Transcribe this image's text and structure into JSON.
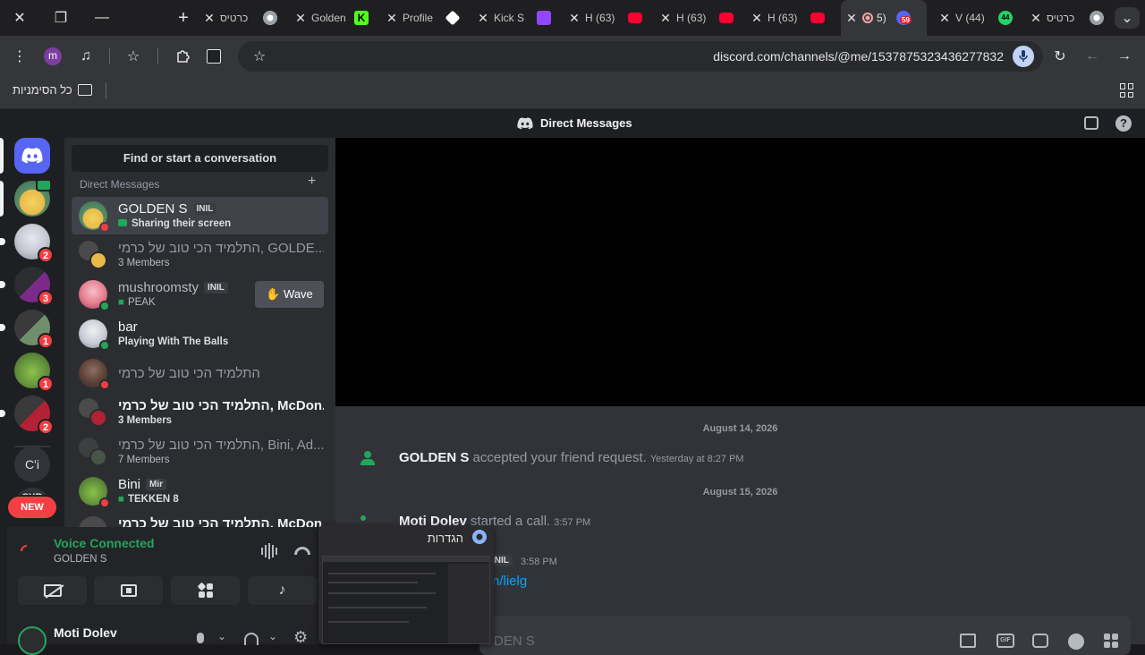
{
  "browser": {
    "tabs": [
      {
        "label": "כרטיס",
        "icon": "chrome-icon"
      },
      {
        "label": "Golden",
        "icon": "kick-icon"
      },
      {
        "label": "Profile",
        "icon": "extension-icon"
      },
      {
        "label": "Kick S",
        "icon": "twitch-icon"
      },
      {
        "label": "(63) H",
        "icon": "youtube-icon"
      },
      {
        "label": "(63) H",
        "icon": "youtube-icon"
      },
      {
        "label": "(63) H",
        "icon": "youtube-icon"
      },
      {
        "label": "(5",
        "icon": "discord-icon",
        "badge": "59"
      },
      {
        "label": "(44) V",
        "icon": "whatsapp-icon",
        "badge": "44"
      },
      {
        "label": "כרטיס",
        "icon": "chrome-icon"
      }
    ],
    "profile_initial": "m",
    "url": "discord.com/channels/@me/1537875323436277832",
    "bookmarks_label": "כל הסימניות"
  },
  "discord": {
    "title": "Direct Messages",
    "guild_badges": [
      "2",
      "3",
      "1",
      "1",
      "2"
    ],
    "guild_text": "C'i",
    "guild_text2": "SYR",
    "new_label": "NEW",
    "find_label": "Find or start a conversation",
    "dm_header": "Direct Messages",
    "dms": [
      {
        "name": "GOLDEN S",
        "tag": "INIL",
        "sub": "Sharing their screen"
      },
      {
        "name": "התלמיד הכי טוב של כרמי, GOLDE...",
        "sub": "3 Members"
      },
      {
        "name": "mushroomsty",
        "tag": "INIL",
        "sub": "PEAK"
      },
      {
        "name": "bar",
        "sub": "Playing With The Balls"
      },
      {
        "name": "התלמיד הכי טוב של כרמי",
        "sub": ""
      },
      {
        "name": "התלמיד הכי טוב של כרמי, McDon...",
        "sub": "3 Members"
      },
      {
        "name": "התלמיד הכי טוב של כרמי, Bini, Ad...",
        "sub": "7 Members"
      },
      {
        "name": "Bini",
        "tag": "Mir",
        "sub": "TEKKEN 8"
      },
      {
        "name": "התלמיד הכי טוב של כרמי, McDon...",
        "sub": ""
      }
    ],
    "wave_label": "Wave",
    "voice": {
      "status": "Voice Connected",
      "channel": "GOLDEN S"
    },
    "user": {
      "name": "Moti Dolev"
    },
    "messages": {
      "date1": "August 14, 2026",
      "friend_name": "GOLDEN S",
      "friend_text": "accepted your friend request.",
      "friend_time": "Yesterday at 8:27 PM",
      "date2": "August 15, 2026",
      "call_name": "Moti Dolev",
      "call_text": "started a call.",
      "call_time": "3:57 PM",
      "msg_tag": "INIL",
      "msg_time": "3:58 PM",
      "msg_link": "n/lielg",
      "input_placeholder": "DEN S"
    },
    "popup_title": "הגדרות"
  },
  "colors": {
    "accent": "#5865f2",
    "green": "#23a55a",
    "red": "#f23f43",
    "link": "#00a8fc"
  }
}
